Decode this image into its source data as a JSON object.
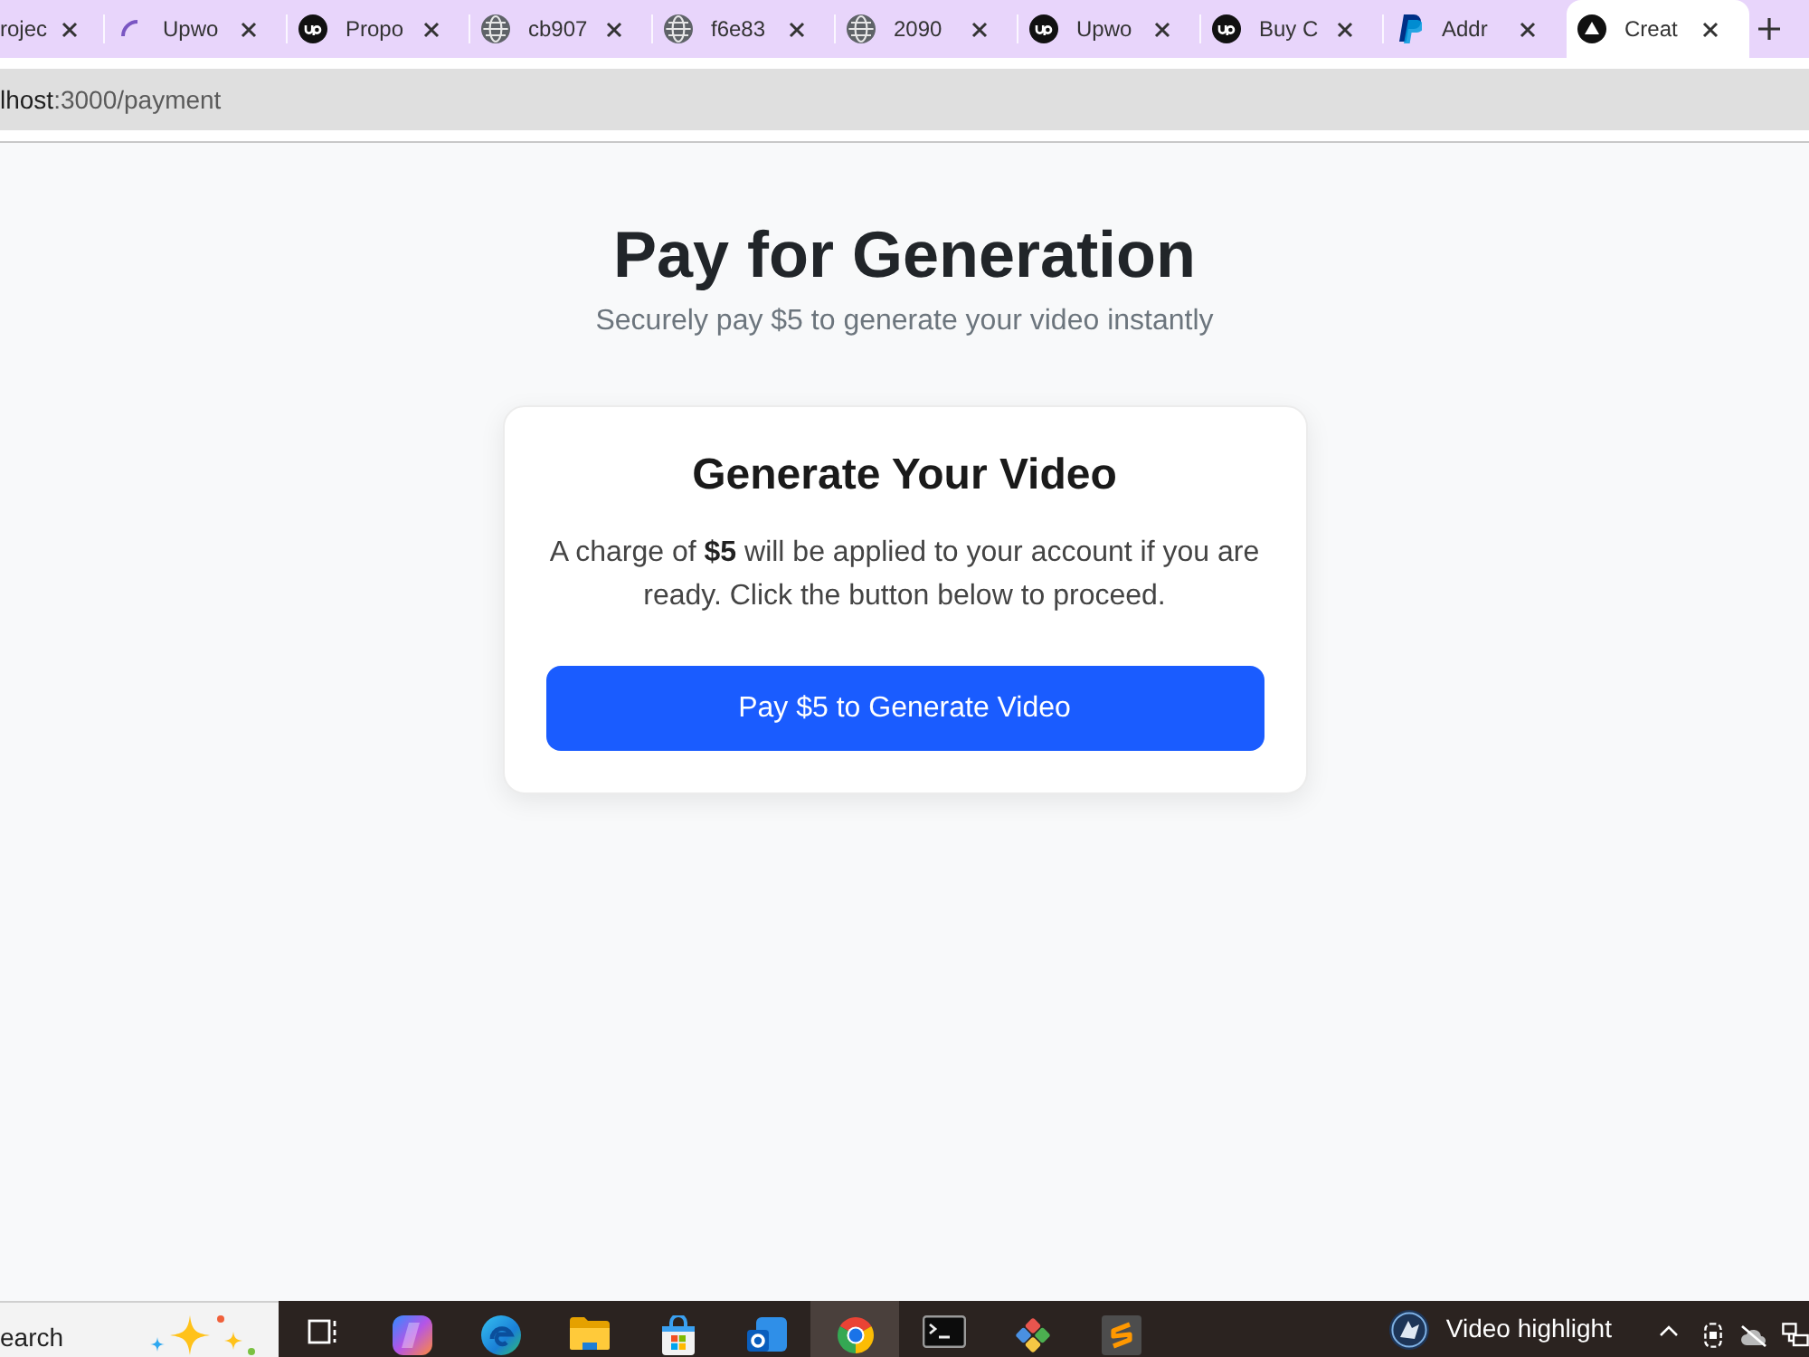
{
  "browser": {
    "tabs": [
      {
        "title": "rojec",
        "kind": "none",
        "selected": false
      },
      {
        "title": "Upwo",
        "kind": "spinner",
        "selected": false
      },
      {
        "title": "Propo",
        "kind": "disc",
        "selected": false
      },
      {
        "title": "cb907",
        "kind": "globe",
        "selected": false
      },
      {
        "title": "f6e83",
        "kind": "globe",
        "selected": false
      },
      {
        "title": "2090",
        "kind": "globe",
        "selected": false
      },
      {
        "title": "Upwo",
        "kind": "disc",
        "selected": false
      },
      {
        "title": "Buy C",
        "kind": "disc",
        "selected": false
      },
      {
        "title": "Addr",
        "kind": "slant",
        "selected": false
      },
      {
        "title": "Creat",
        "kind": "triangle",
        "selected": true
      }
    ],
    "address_bar": {
      "host": "lhost",
      "path": ":3000/payment"
    }
  },
  "page": {
    "title": "Pay for Generation",
    "subtitle": "Securely pay $5 to generate your video instantly",
    "card": {
      "title": "Generate Your Video",
      "text": "A charge of **$5** will be applied to your account if you are ready. Click the button below to proceed.",
      "button": "Pay $5 to Generate Video"
    }
  },
  "taskbar": {
    "search": {
      "placeholder": "earch"
    },
    "apps": [
      {
        "kind": "taskview",
        "active": false
      },
      {
        "kind": "gradient",
        "active": false
      },
      {
        "kind": "swirl",
        "active": false
      },
      {
        "kind": "folder",
        "active": false
      },
      {
        "kind": "bag",
        "active": false
      },
      {
        "kind": "ringtile",
        "active": false
      },
      {
        "kind": "wheel",
        "active": true
      },
      {
        "kind": "terminal",
        "active": false
      },
      {
        "kind": "diamond",
        "active": false
      },
      {
        "kind": "zigzag",
        "active": false
      }
    ],
    "widget": {
      "text": "Video highlight"
    }
  }
}
